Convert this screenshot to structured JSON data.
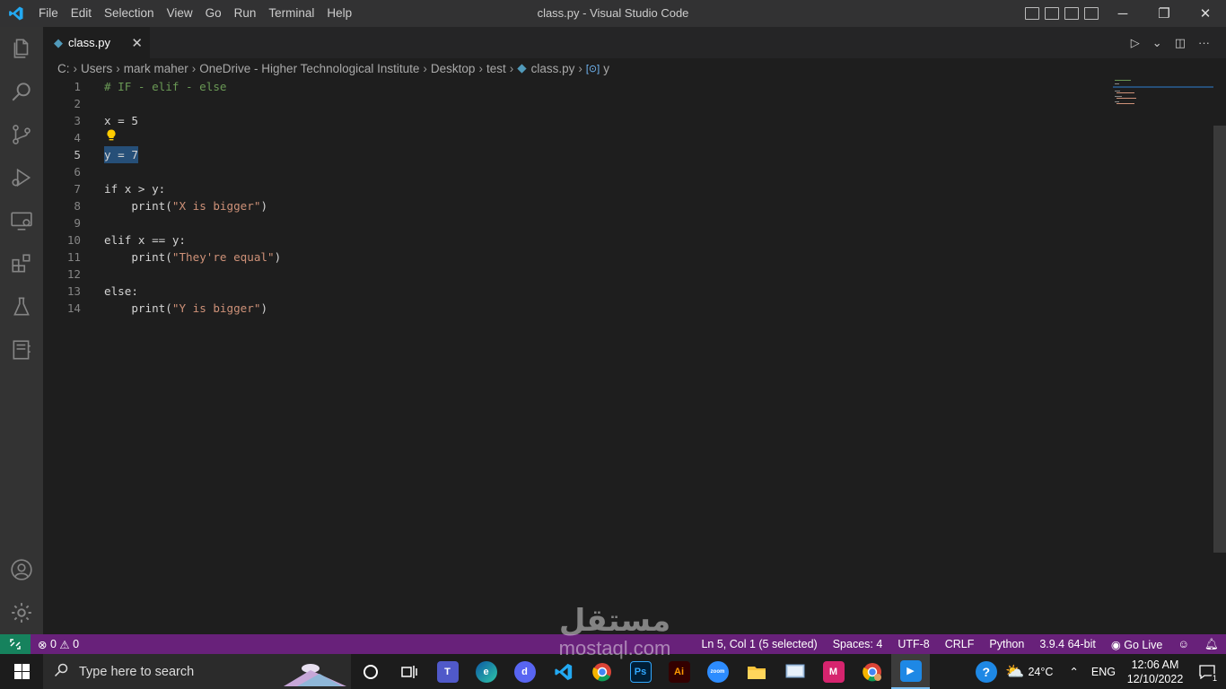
{
  "window": {
    "title": "class.py - Visual Studio Code",
    "menu": [
      "File",
      "Edit",
      "Selection",
      "View",
      "Go",
      "Run",
      "Terminal",
      "Help"
    ],
    "controls": {
      "minimize": "─",
      "restore": "❐",
      "close": "✕"
    }
  },
  "activity_bar": [
    "files-icon",
    "search-icon",
    "source-control-icon",
    "run-debug-icon",
    "remote-explorer-icon",
    "extensions-icon",
    "testing-icon",
    "notebook-icon"
  ],
  "activity_bar_bottom": [
    "accounts-icon",
    "settings-gear-icon"
  ],
  "tab": {
    "label": "class.py",
    "close": "✕"
  },
  "breadcrumb": [
    "C:",
    "Users",
    "mark maher",
    "OneDrive - Higher Technological Institute",
    "Desktop",
    "test",
    "class.py",
    "y"
  ],
  "editor": {
    "line_numbers": [
      "1",
      "2",
      "3",
      "4",
      "5",
      "6",
      "7",
      "8",
      "9",
      "10",
      "11",
      "12",
      "13",
      "14"
    ],
    "lines": {
      "l1": "# IF - elif - else",
      "l3": "x = 5",
      "l5": "y = 7",
      "l7a": "if",
      "l7b": " x > y:",
      "l8a": "    ",
      "l8b": "print",
      "l8c": "(",
      "l8d": "\"X is bigger\"",
      "l8e": ")",
      "l10a": "elif",
      "l10b": " x == y:",
      "l11b": "print",
      "l11c": "(",
      "l11d": "\"They're equal\"",
      "l11e": ")",
      "l13a": "else",
      "l13b": ":",
      "l14b": "print",
      "l14c": "(",
      "l14d": "\"Y is bigger\"",
      "l14e": ")"
    }
  },
  "status_bar": {
    "errors": "0",
    "warnings": "0",
    "position": "Ln 5, Col 1 (5 selected)",
    "spaces": "Spaces: 4",
    "encoding": "UTF-8",
    "eol": "CRLF",
    "language": "Python",
    "interpreter": "3.9.4 64-bit",
    "go_live": "Go Live"
  },
  "taskbar": {
    "search_placeholder": "Type here to search",
    "apps": [
      "cortana-icon",
      "task-view-icon",
      "teams-icon",
      "edge-icon",
      "discord-icon",
      "vscode-icon",
      "chrome-icon",
      "photoshop-icon",
      "illustrator-icon",
      "zoom-icon",
      "file-explorer-icon",
      "control-panel-icon",
      "app-m-icon",
      "chrome-profile-icon",
      "media-player-icon"
    ],
    "weather": "24°C",
    "language": "ENG",
    "time": "12:06 AM",
    "date": "12/10/2022",
    "notifications": "1",
    "ps_label": "Ps",
    "ai_label": "Ai",
    "zoom_label": "zoom"
  },
  "watermark": {
    "arabic": "مستقل",
    "latin": "mostaql.com"
  },
  "colors": {
    "statusbar": "#68217a",
    "accent": "#007acc",
    "selection": "#264f78"
  }
}
